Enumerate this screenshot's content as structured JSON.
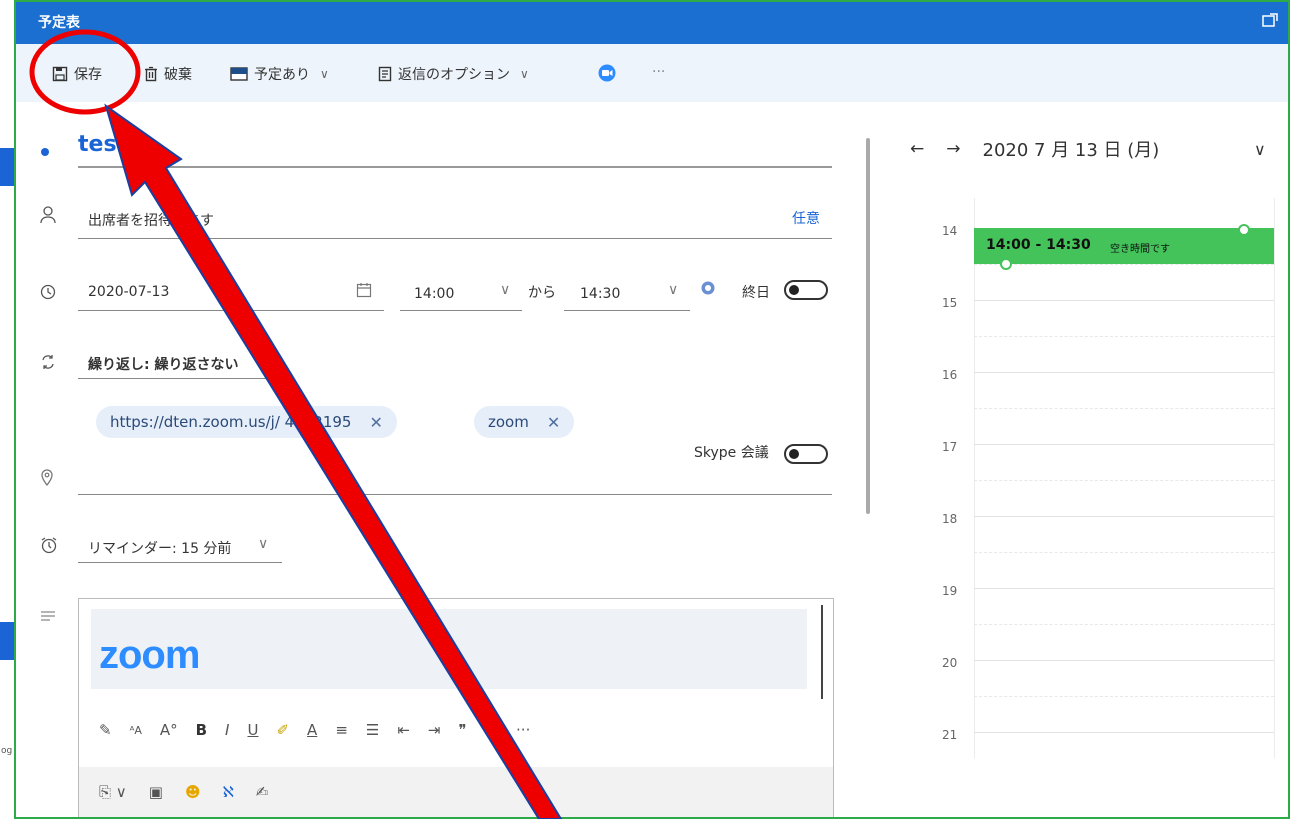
{
  "window": {
    "title": "予定表"
  },
  "toolbar": {
    "save": "保存",
    "discard": "破棄",
    "show_as": "予定あり",
    "response_options": "返信のオプション",
    "more": "···"
  },
  "form": {
    "title_value": "test",
    "attendees_placeholder": "出席者を招待します",
    "optional_link": "任意",
    "start_date": "2020-07-13",
    "start_time": "14:00",
    "from_label": "から",
    "end_time": "14:30",
    "all_day_label": "終日",
    "repeat": "繰り返し: 繰り返さない",
    "location_chips": [
      "https://dten.zoom.us/j/   4812195",
      "zoom"
    ],
    "skype_label": "Skype 会議",
    "reminder": "リマインダー: 15 分前",
    "body_logo": "zoom"
  },
  "calendar": {
    "date_label": "2020 7 月 13 日 (月)",
    "hours": [
      "14",
      "15",
      "16",
      "17",
      "18",
      "19",
      "20",
      "21"
    ],
    "event": {
      "time": "14:00 - 14:30",
      "status": "空き時間です"
    }
  },
  "sidebar_hint": {
    "tab_label": "og"
  },
  "colors": {
    "title_bar": "#1a6fd0",
    "toolbar_bg": "#eef4fb",
    "event_green": "#43c35a",
    "annotation_red": "#ee0000",
    "frame_green": "#2eaa48"
  }
}
